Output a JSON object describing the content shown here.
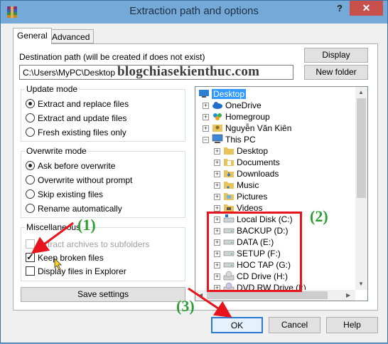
{
  "window": {
    "title": "Extraction path and options",
    "help_glyph": "?",
    "close_glyph": "✕"
  },
  "tabs": [
    {
      "label": "General",
      "active": true
    },
    {
      "label": "Advanced",
      "active": false
    }
  ],
  "destination": {
    "label": "Destination path (will be created if does not exist)",
    "value": "C:\\Users\\MyPC\\Desktop",
    "display_button": "Display",
    "new_folder_button": "New folder"
  },
  "watermark": "blogchiasekienthuc.com",
  "update_mode": {
    "title": "Update mode",
    "options": [
      {
        "label": "Extract and replace files",
        "selected": true
      },
      {
        "label": "Extract and update files",
        "selected": false
      },
      {
        "label": "Fresh existing files only",
        "selected": false
      }
    ]
  },
  "overwrite_mode": {
    "title": "Overwrite mode",
    "options": [
      {
        "label": "Ask before overwrite",
        "selected": true
      },
      {
        "label": "Overwrite without prompt",
        "selected": false
      },
      {
        "label": "Skip existing files",
        "selected": false
      },
      {
        "label": "Rename automatically",
        "selected": false
      }
    ]
  },
  "misc": {
    "title": "Miscellaneous",
    "options": [
      {
        "label": "Extract archives to subfolders",
        "checked": false,
        "disabled": true
      },
      {
        "label": "Keep broken files",
        "checked": true,
        "disabled": false
      },
      {
        "label": "Display files in Explorer",
        "checked": false,
        "disabled": false
      }
    ]
  },
  "save_settings_button": "Save settings",
  "tree": {
    "items": [
      {
        "label": "Desktop",
        "icon": "desktop-folder-icon",
        "level": 0,
        "expander": "",
        "selected": true
      },
      {
        "label": "OneDrive",
        "icon": "onedrive-cloud-icon",
        "level": 1,
        "expander": "+"
      },
      {
        "label": "Homegroup",
        "icon": "homegroup-icon",
        "level": 1,
        "expander": "+"
      },
      {
        "label": "Nguyễn Văn Kiên",
        "icon": "user-folder-icon",
        "level": 1,
        "expander": "+"
      },
      {
        "label": "This PC",
        "icon": "computer-icon",
        "level": 1,
        "expander": "−"
      },
      {
        "label": "Desktop",
        "icon": "folder-icon",
        "level": 2,
        "expander": "+"
      },
      {
        "label": "Documents",
        "icon": "documents-icon",
        "level": 2,
        "expander": "+"
      },
      {
        "label": "Downloads",
        "icon": "downloads-icon",
        "level": 2,
        "expander": "+"
      },
      {
        "label": "Music",
        "icon": "music-icon",
        "level": 2,
        "expander": "+"
      },
      {
        "label": "Pictures",
        "icon": "pictures-icon",
        "level": 2,
        "expander": "+"
      },
      {
        "label": "Videos",
        "icon": "videos-icon",
        "level": 2,
        "expander": "+"
      },
      {
        "label": "Local Disk (C:)",
        "icon": "windows-drive-icon",
        "level": 2,
        "expander": "+"
      },
      {
        "label": "BACKUP (D:)",
        "icon": "drive-icon",
        "level": 2,
        "expander": "+"
      },
      {
        "label": "DATA (E:)",
        "icon": "drive-icon",
        "level": 2,
        "expander": "+"
      },
      {
        "label": "SETUP (F:)",
        "icon": "drive-icon",
        "level": 2,
        "expander": "+"
      },
      {
        "label": "HOC TAP (G:)",
        "icon": "drive-icon",
        "level": 2,
        "expander": "+"
      },
      {
        "label": "CD Drive (H:)",
        "icon": "cd-drive-icon",
        "level": 2,
        "expander": "+"
      },
      {
        "label": "DVD RW Drive (I:)",
        "icon": "dvd-drive-icon",
        "level": 2,
        "expander": "+"
      }
    ]
  },
  "buttons": {
    "ok": "OK",
    "cancel": "Cancel",
    "help": "Help"
  },
  "annotations": {
    "one": "(1)",
    "two": "(2)",
    "three": "(3)",
    "accent_red": "#e8141d",
    "accent_green": "#2e9e32"
  }
}
